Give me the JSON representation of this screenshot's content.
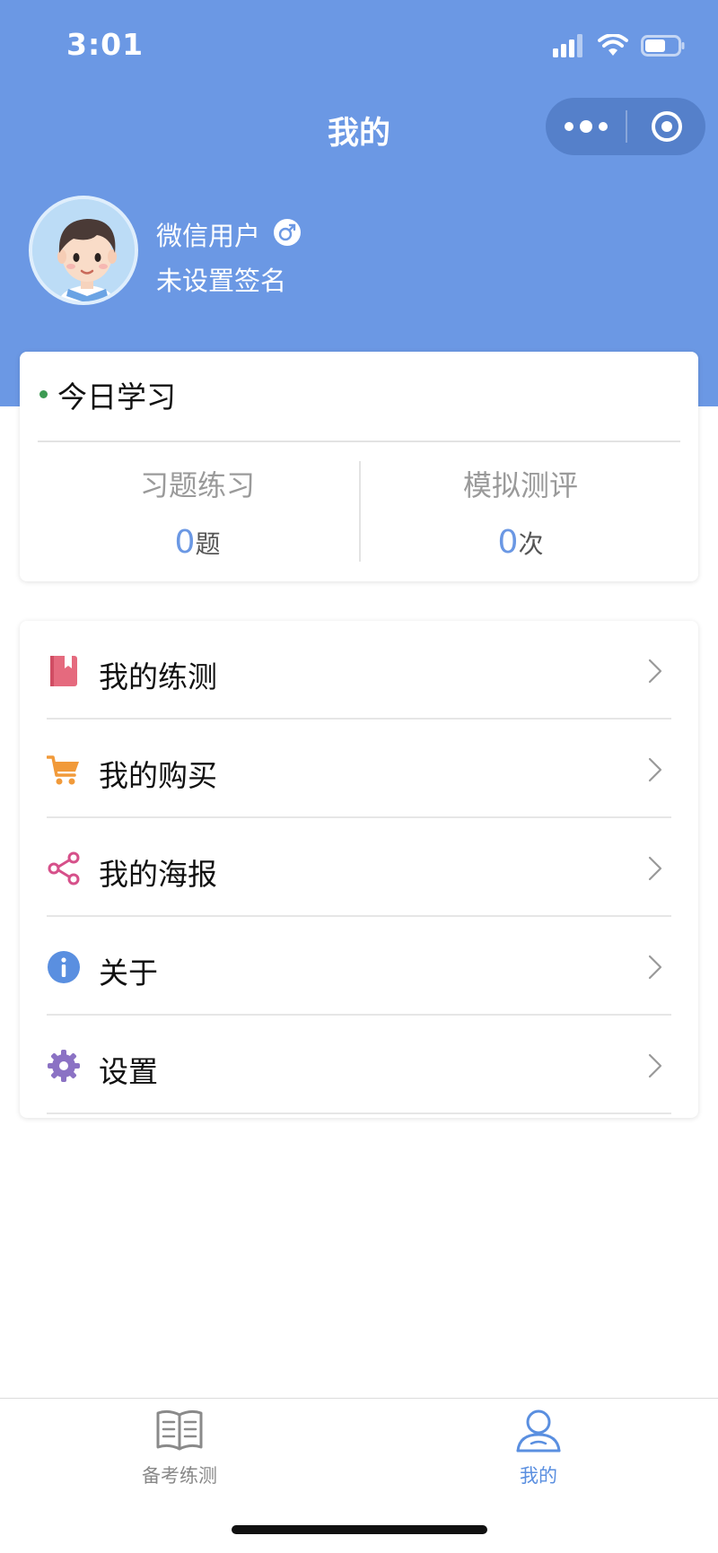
{
  "status_bar": {
    "time": "3:01"
  },
  "nav": {
    "title": "我的"
  },
  "profile": {
    "name": "微信用户",
    "signature": "未设置签名"
  },
  "today": {
    "title": "今日学习",
    "stats": [
      {
        "label": "习题练习",
        "value": "0",
        "unit": "题"
      },
      {
        "label": "模拟测评",
        "value": "0",
        "unit": "次"
      }
    ]
  },
  "menu": {
    "items": [
      {
        "label": "我的练测",
        "icon": "book-icon",
        "color": "#e56a7e"
      },
      {
        "label": "我的购买",
        "icon": "cart-icon",
        "color": "#f19a3a"
      },
      {
        "label": "我的海报",
        "icon": "share-icon",
        "color": "#d6508a"
      },
      {
        "label": "关于",
        "icon": "info-icon",
        "color": "#5a8fe0"
      },
      {
        "label": "设置",
        "icon": "gear-icon",
        "color": "#8b72c4"
      }
    ]
  },
  "tabbar": {
    "tabs": [
      {
        "label": "备考练测",
        "icon": "open-book-icon",
        "active": false
      },
      {
        "label": "我的",
        "icon": "person-icon",
        "active": true
      }
    ]
  },
  "colors": {
    "header": "#6b98e4",
    "accent": "#5a8fe0"
  }
}
